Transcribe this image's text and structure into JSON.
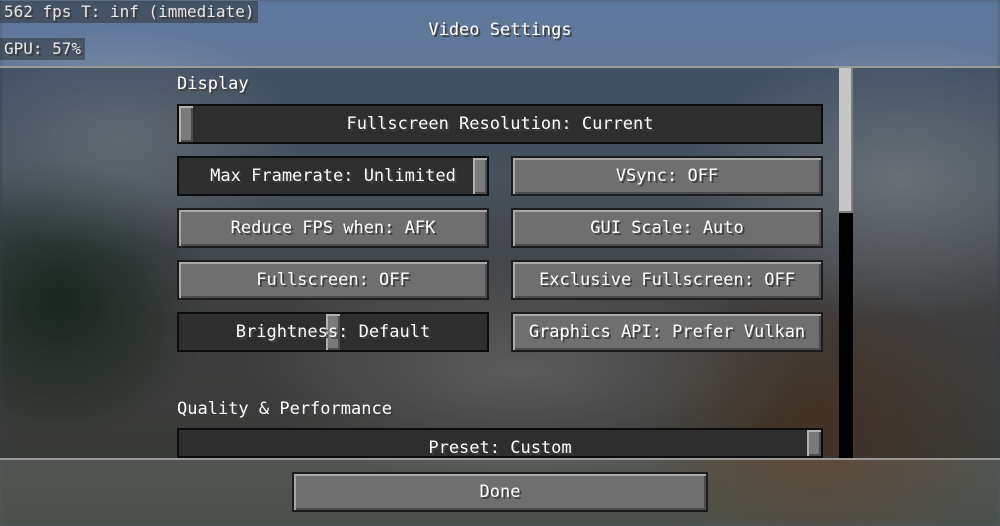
{
  "hud": {
    "fps_line": "562 fps T: inf (immediate)",
    "gpu_line": "GPU: 57%"
  },
  "screen": {
    "title": "Video Settings"
  },
  "sections": {
    "display": "Display",
    "quality": "Quality & Performance"
  },
  "controls": {
    "fullscreen_resolution": {
      "label": "Fullscreen Resolution: Current",
      "slider_position": 0.0
    },
    "max_framerate": {
      "label": "Max Framerate: Unlimited",
      "slider_position": 1.0
    },
    "vsync": "VSync: OFF",
    "reduce_fps": "Reduce FPS when: AFK",
    "gui_scale": "GUI Scale: Auto",
    "fullscreen": "Fullscreen: OFF",
    "exclusive_fullscreen": "Exclusive Fullscreen: OFF",
    "brightness": {
      "label": "Brightness: Default",
      "slider_position": 0.5
    },
    "graphics_api": "Graphics API: Prefer Vulkan",
    "preset": {
      "label": "Preset: Custom",
      "slider_position": 1.0
    }
  },
  "footer": {
    "done_label": "Done"
  },
  "colors": {
    "button_face": "#6f6f6f",
    "slider_track": "#2e2e2e",
    "scrollbar_thumb": "#c6c6c6"
  }
}
